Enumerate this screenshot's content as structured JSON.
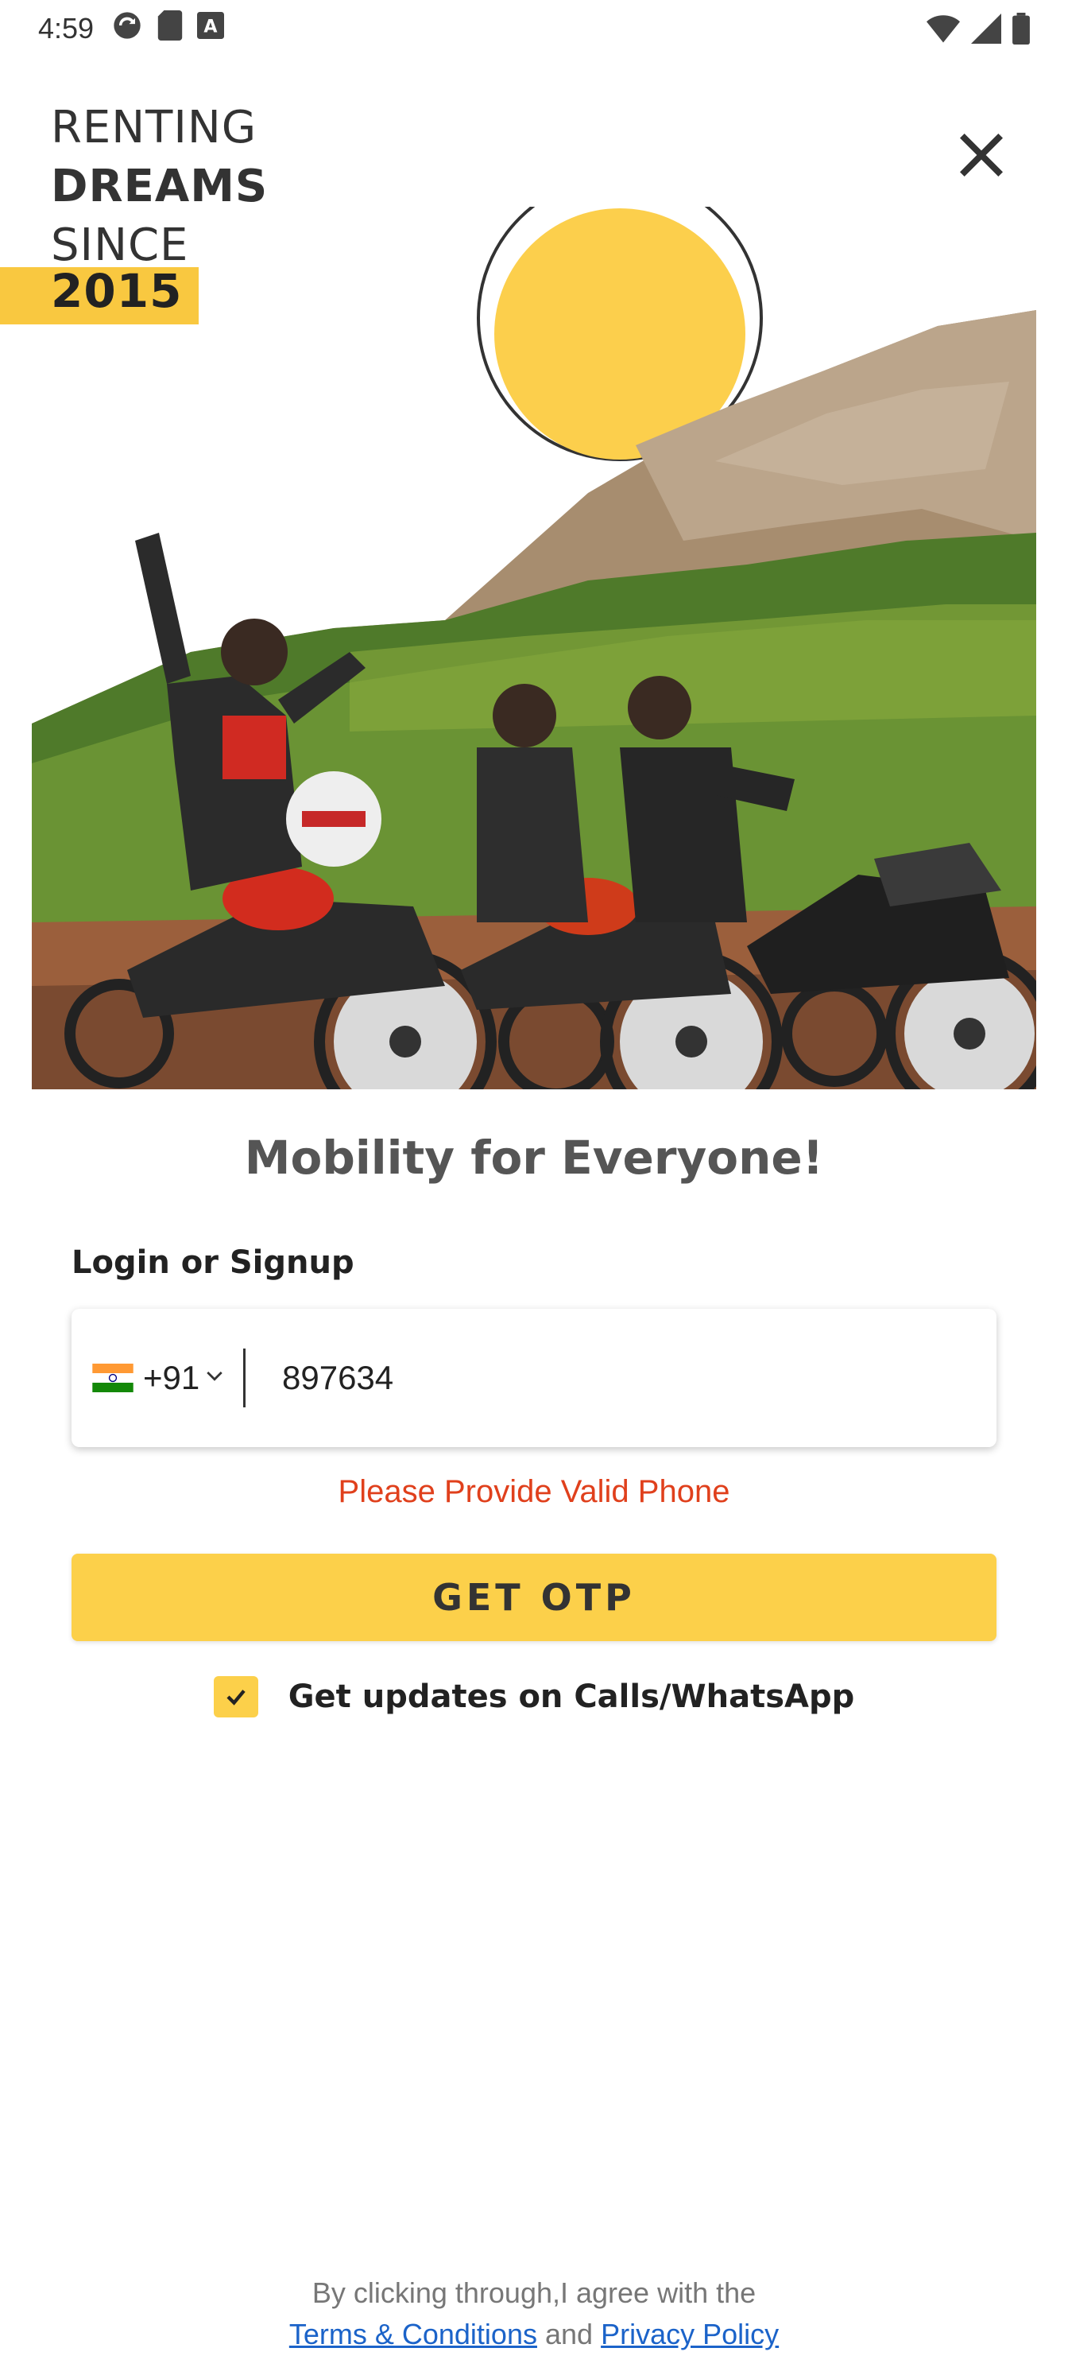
{
  "status_bar": {
    "time": "4:59"
  },
  "hero": {
    "title_lines": [
      "RENTING",
      "DREAMS",
      "SINCE"
    ],
    "year": "2015",
    "accent_color": "#f9c840"
  },
  "main": {
    "tagline": "Mobility for Everyone!",
    "login_label": "Login or Signup",
    "phone": {
      "country_code": "+91",
      "value": "897634"
    },
    "error_message": "Please Provide Valid Phone",
    "otp_button_label": "GET OTP",
    "updates_label": "Get updates on Calls/WhatsApp",
    "updates_checked": true
  },
  "footer": {
    "agreement_text": "By clicking through,I agree with the",
    "terms_link": "Terms & Conditions",
    "and_text": "and",
    "privacy_link": "Privacy Policy"
  },
  "colors": {
    "primary_yellow": "#fcd04a",
    "error_red": "#e0401c",
    "link_blue": "#1b63c9"
  }
}
